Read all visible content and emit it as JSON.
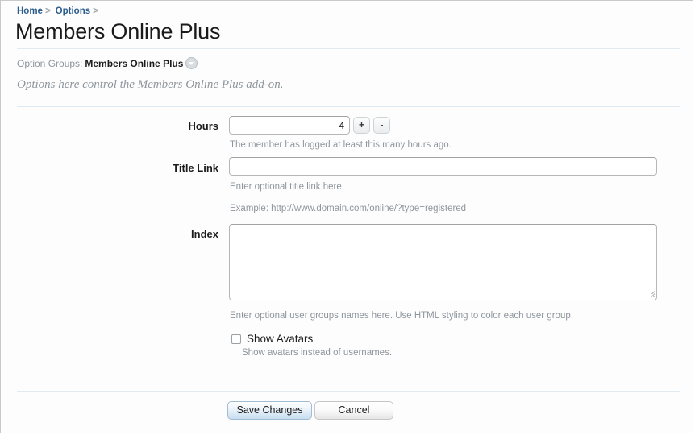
{
  "breadcrumb": {
    "items": [
      {
        "label": "Home",
        "separator": ">"
      },
      {
        "label": "Options",
        "separator": ">"
      }
    ]
  },
  "header": {
    "title": "Members Online Plus"
  },
  "option_groups": {
    "label": "Option Groups:",
    "value": "Members Online Plus",
    "dropdown_icon": "chevron-down-circle-icon",
    "description": "Options here control the Members Online Plus add-on."
  },
  "form": {
    "fields": [
      {
        "label": "Hours",
        "type": "number-stepper",
        "value": "4",
        "placeholder": "",
        "increment_label": "+",
        "decrement_label": "-",
        "hint": "The member has logged at least this many hours ago."
      },
      {
        "label": "Title Link",
        "type": "text",
        "value": "",
        "placeholder": "",
        "hint": "Enter optional title link here.",
        "example": "Example: http://www.domain.com/online/?type=registered"
      },
      {
        "label": "Index",
        "type": "textarea",
        "value": "",
        "placeholder": "",
        "hint": "Enter optional user groups names here. Use HTML styling to color each user group."
      }
    ],
    "checkbox": {
      "label": "Show Avatars",
      "checked": false,
      "hint": "Show avatars instead of usernames."
    }
  },
  "footer": {
    "save_label": "Save Changes",
    "cancel_label": "Cancel"
  },
  "colors": {
    "link": "#2b5d8c",
    "muted_text": "#8e969d",
    "rule": "#dfeaf3",
    "primary_button_border": "#9fbdd4",
    "page_border": "#c9c9c9"
  }
}
